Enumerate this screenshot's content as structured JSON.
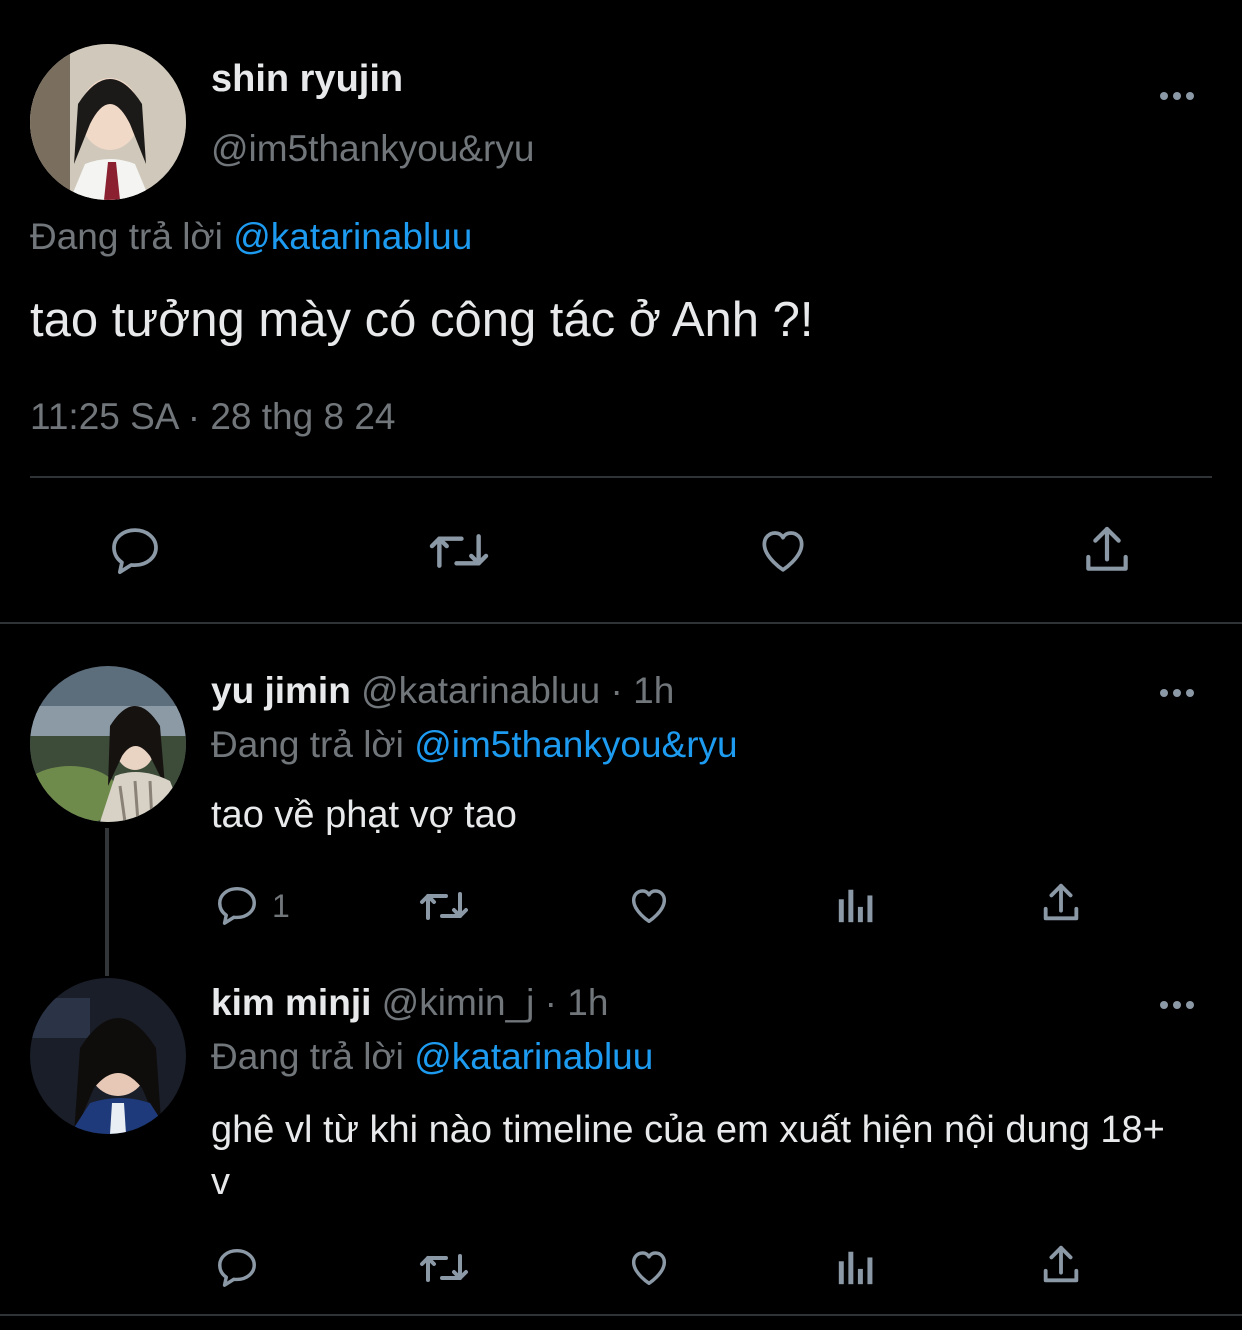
{
  "main_tweet": {
    "display_name": "shin ryujin",
    "handle": "@im5thankyou&ryu",
    "replying_prefix": "Đang trả lời",
    "replying_to": "@katarinabluu",
    "text": "tao tưởng mày có công tác ở Anh ?!",
    "timestamp": "11:25 SA · 28 thg 8 24",
    "actions": [
      "reply-icon",
      "retweet-icon",
      "like-icon",
      "share-icon"
    ]
  },
  "replies": [
    {
      "display_name": "yu jimin",
      "handle": "@katarinabluu",
      "separator": "·",
      "time": "1h",
      "replying_prefix": "Đang trả lời",
      "replying_to": "@im5thankyou&ryu",
      "text": "tao về phạt vợ tao",
      "reply_count": "1"
    },
    {
      "display_name": "kim minji",
      "handle": "@kimin_j",
      "separator": "·",
      "time": "1h",
      "replying_prefix": "Đang trả lời",
      "replying_to": "@katarinabluu",
      "text": "ghê vl từ khi nào timeline của em xuất hiện nội dung 18+ v",
      "reply_count": ""
    }
  ],
  "colors": {
    "background": "#000000",
    "text": "#e7e9ea",
    "muted": "#71767b",
    "accent": "#1d9bf0",
    "divider": "#2f3336"
  }
}
